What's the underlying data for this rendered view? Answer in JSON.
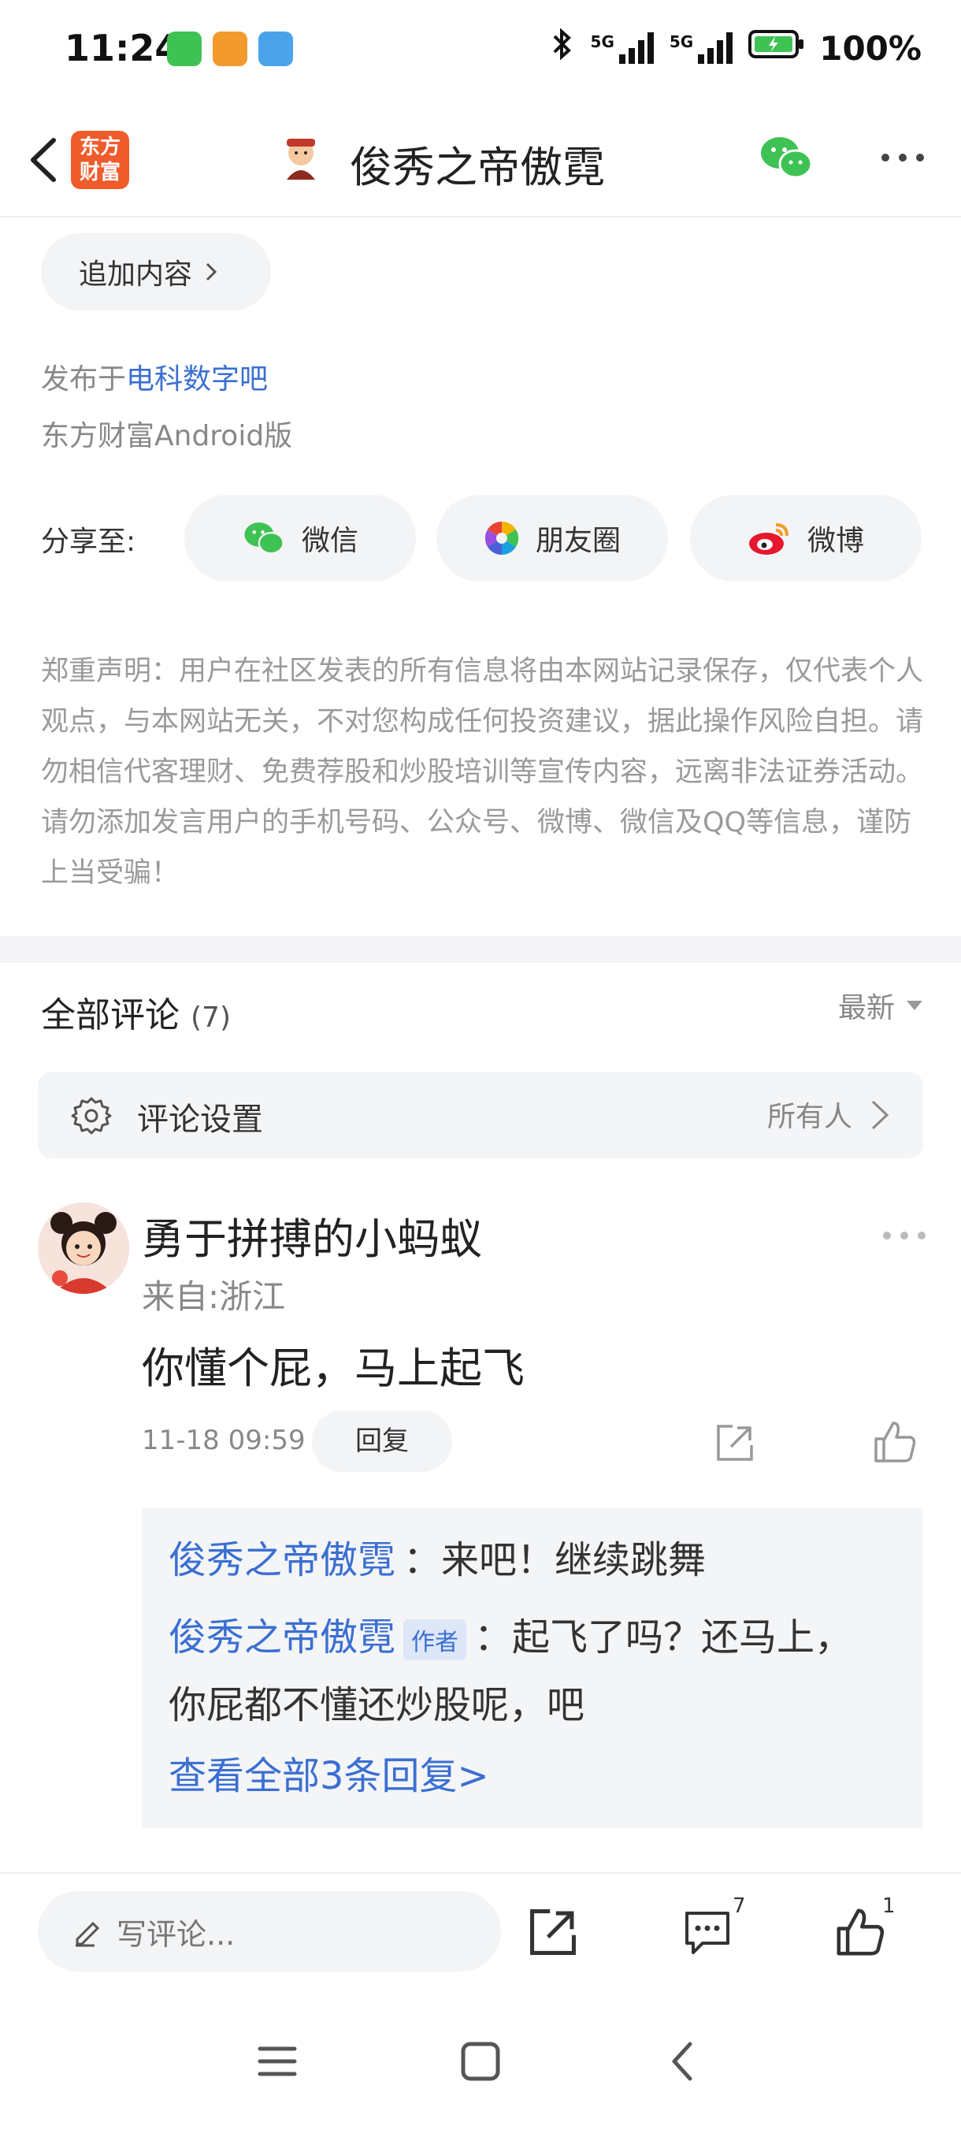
{
  "status_bar": {
    "time": "11:24",
    "network_1": "5G",
    "network_2": "5G",
    "battery": "100%"
  },
  "header": {
    "logo_line1": "东方",
    "logo_line2": "财富",
    "title": "俊秀之帝傲霓"
  },
  "post": {
    "add_content_label": "追加内容",
    "posted_prefix": "发布于",
    "posted_board": "电科数字吧",
    "client": "东方财富Android版"
  },
  "share": {
    "label": "分享至:",
    "wechat": "微信",
    "moments": "朋友圈",
    "weibo": "微博"
  },
  "disclaimer": "郑重声明：用户在社区发表的所有信息将由本网站记录保存，仅代表个人观点，与本网站无关，不对您构成任何投资建议，据此操作风险自担。请勿相信代客理财、免费荐股和炒股培训等宣传内容，远离非法证券活动。请勿添加发言用户的手机号码、公众号、微博、微信及QQ等信息，谨防上当受骗！",
  "comments": {
    "title": "全部评论",
    "count": "(7)",
    "sort": "最新",
    "settings_label": "评论设置",
    "settings_value": "所有人"
  },
  "comment": {
    "author": "勇于拼搏的小蚂蚁",
    "from": "来自:浙江",
    "text": "你懂个屁，马上起飞",
    "time": "11-18 09:59",
    "reply_label": "回复",
    "replies": [
      {
        "user": "俊秀之帝傲霓",
        "text": "：来吧！继续跳舞"
      },
      {
        "user": "俊秀之帝傲霓",
        "tag": "作者",
        "text": "：起飞了吗？还马上，",
        "text_line2": "你屁都不懂还炒股呢，吧"
      }
    ],
    "view_all": "查看全部3条回复>"
  },
  "bottom_bar": {
    "write_placeholder": "写评论...",
    "comment_badge": "7",
    "like_badge": "1"
  },
  "colors": {
    "link_blue": "#3b6fd1",
    "logo_orange": "#ef5b2b",
    "wechat_green": "#3fc254"
  }
}
